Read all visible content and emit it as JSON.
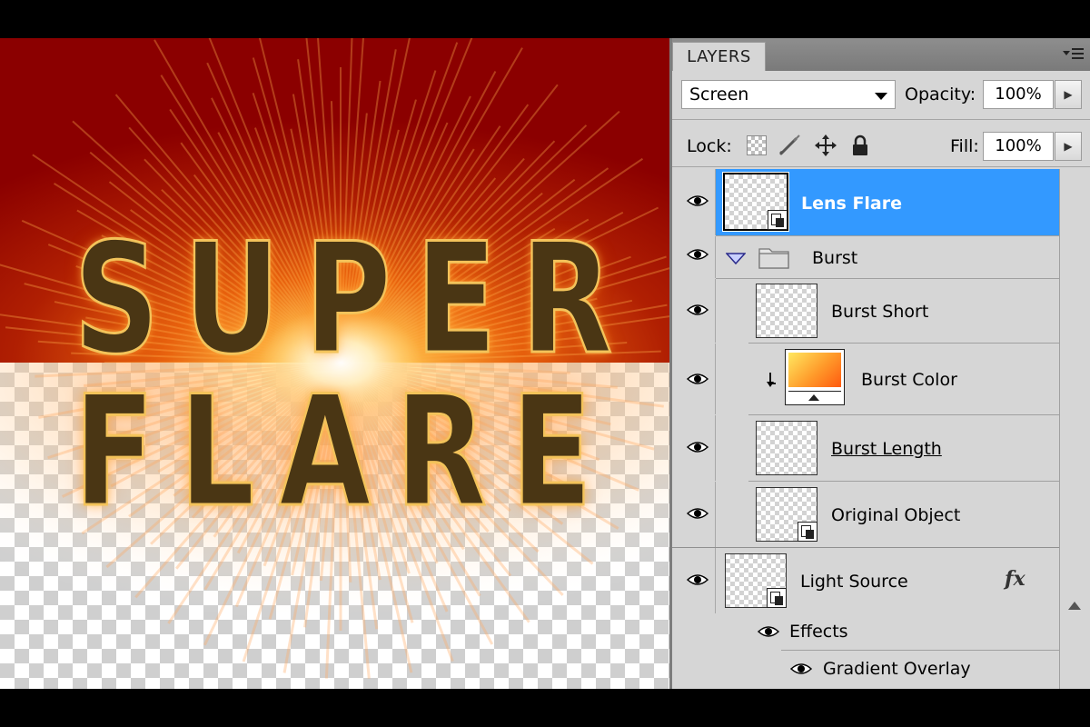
{
  "artwork": {
    "line1": "SUPER",
    "line2": "FLARE"
  },
  "colors": {
    "canvas_red": "#8b0000",
    "selection_blue": "#3399ff",
    "panel_gray": "#d6d6d6"
  },
  "panel": {
    "tab_label": "LAYERS",
    "menu_icon": "panel-menu-icon",
    "blend_mode": "Screen",
    "opacity_label": "Opacity:",
    "opacity_value": "100%",
    "lock_label": "Lock:",
    "fill_label": "Fill:",
    "fill_value": "100%",
    "lock_icons": [
      "lock-transparent-pixels-icon",
      "lock-image-pixels-icon",
      "lock-position-icon",
      "lock-all-icon"
    ]
  },
  "layers": [
    {
      "name": "Lens Flare",
      "visible": true,
      "selected": true,
      "type": "smart-object"
    },
    {
      "name": "Burst",
      "visible": true,
      "type": "group",
      "expanded": true
    },
    {
      "name": "Burst Short",
      "visible": true,
      "type": "layer"
    },
    {
      "name": "Burst Color",
      "visible": true,
      "type": "gradient-fill",
      "clipped": true
    },
    {
      "name": "Burst Length",
      "visible": true,
      "type": "layer"
    },
    {
      "name": "Original Object",
      "visible": true,
      "type": "smart-object"
    },
    {
      "name": "Light Source",
      "visible": true,
      "type": "smart-object",
      "fx": "fx"
    }
  ],
  "effects": {
    "label": "Effects",
    "items": [
      "Gradient Overlay"
    ]
  }
}
